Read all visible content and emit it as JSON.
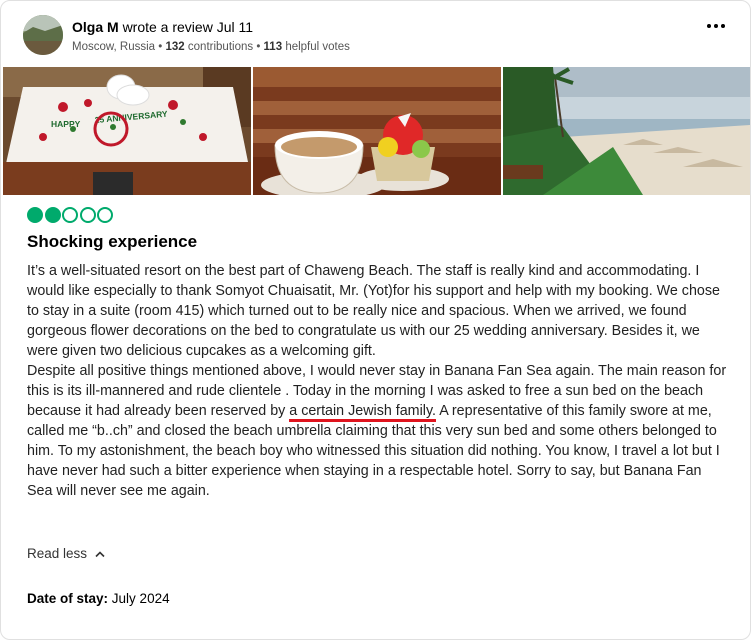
{
  "review": {
    "author": "Olga M",
    "action": "wrote a review Jul 11",
    "location": "Moscow, Russia",
    "contributions_count": "132",
    "contributions_label": "contributions",
    "helpful_count": "113",
    "helpful_label": "helpful votes",
    "menu_icon": "more-horizontal-icon",
    "rating": 2,
    "rating_max": 5,
    "rating_color": "#00aa6c",
    "title": "Shocking experience",
    "paragraph1": "It’s a well-situated resort on the best part of Chaweng Beach. The staff is really kind and accommodating. I would like especially to thank Somyot Chuaisatit, Mr. (Yot)for his support and help with my booking. We chose to stay in a suite (room 415) which turned out to be really nice and spacious. When we arrived, we found gorgeous flower decorations on the bed to congratulate us with our 25 wedding anniversary. Besides it, we were given two delicious cupcakes as a welcoming gift.",
    "paragraph2_before": "Despite all positive things mentioned above, I would never stay in Banana Fan Sea again. The main reason for this is its ill-mannered and rude clientele . Today in the morning I was asked to free a sun bed on the beach because it had already been reserved by ",
    "paragraph2_highlight": "a certain Jewish family.",
    "paragraph2_after": " A representative of this family swore at me, called me “b..ch” and closed the beach umbrella claiming that this very sun bed and some others belonged to him. To my astonishment, the beach boy who witnessed this situation did nothing. You know, I travel a lot but I have never had such a bitter experience when staying in a respectable hotel. Sorry to say, but Banana Fan Sea will never see me again.",
    "highlight_color": "#e0141e",
    "read_less": "Read less",
    "date_label": "Date of stay:",
    "date_value": "July 2024"
  },
  "photos": [
    {
      "name": "anniversary-bed-photo",
      "bed_text_left": "HAPPY",
      "bed_text_right": "25 ANNIVERSARY"
    },
    {
      "name": "coffee-cupcake-photo"
    },
    {
      "name": "beach-photo"
    }
  ]
}
